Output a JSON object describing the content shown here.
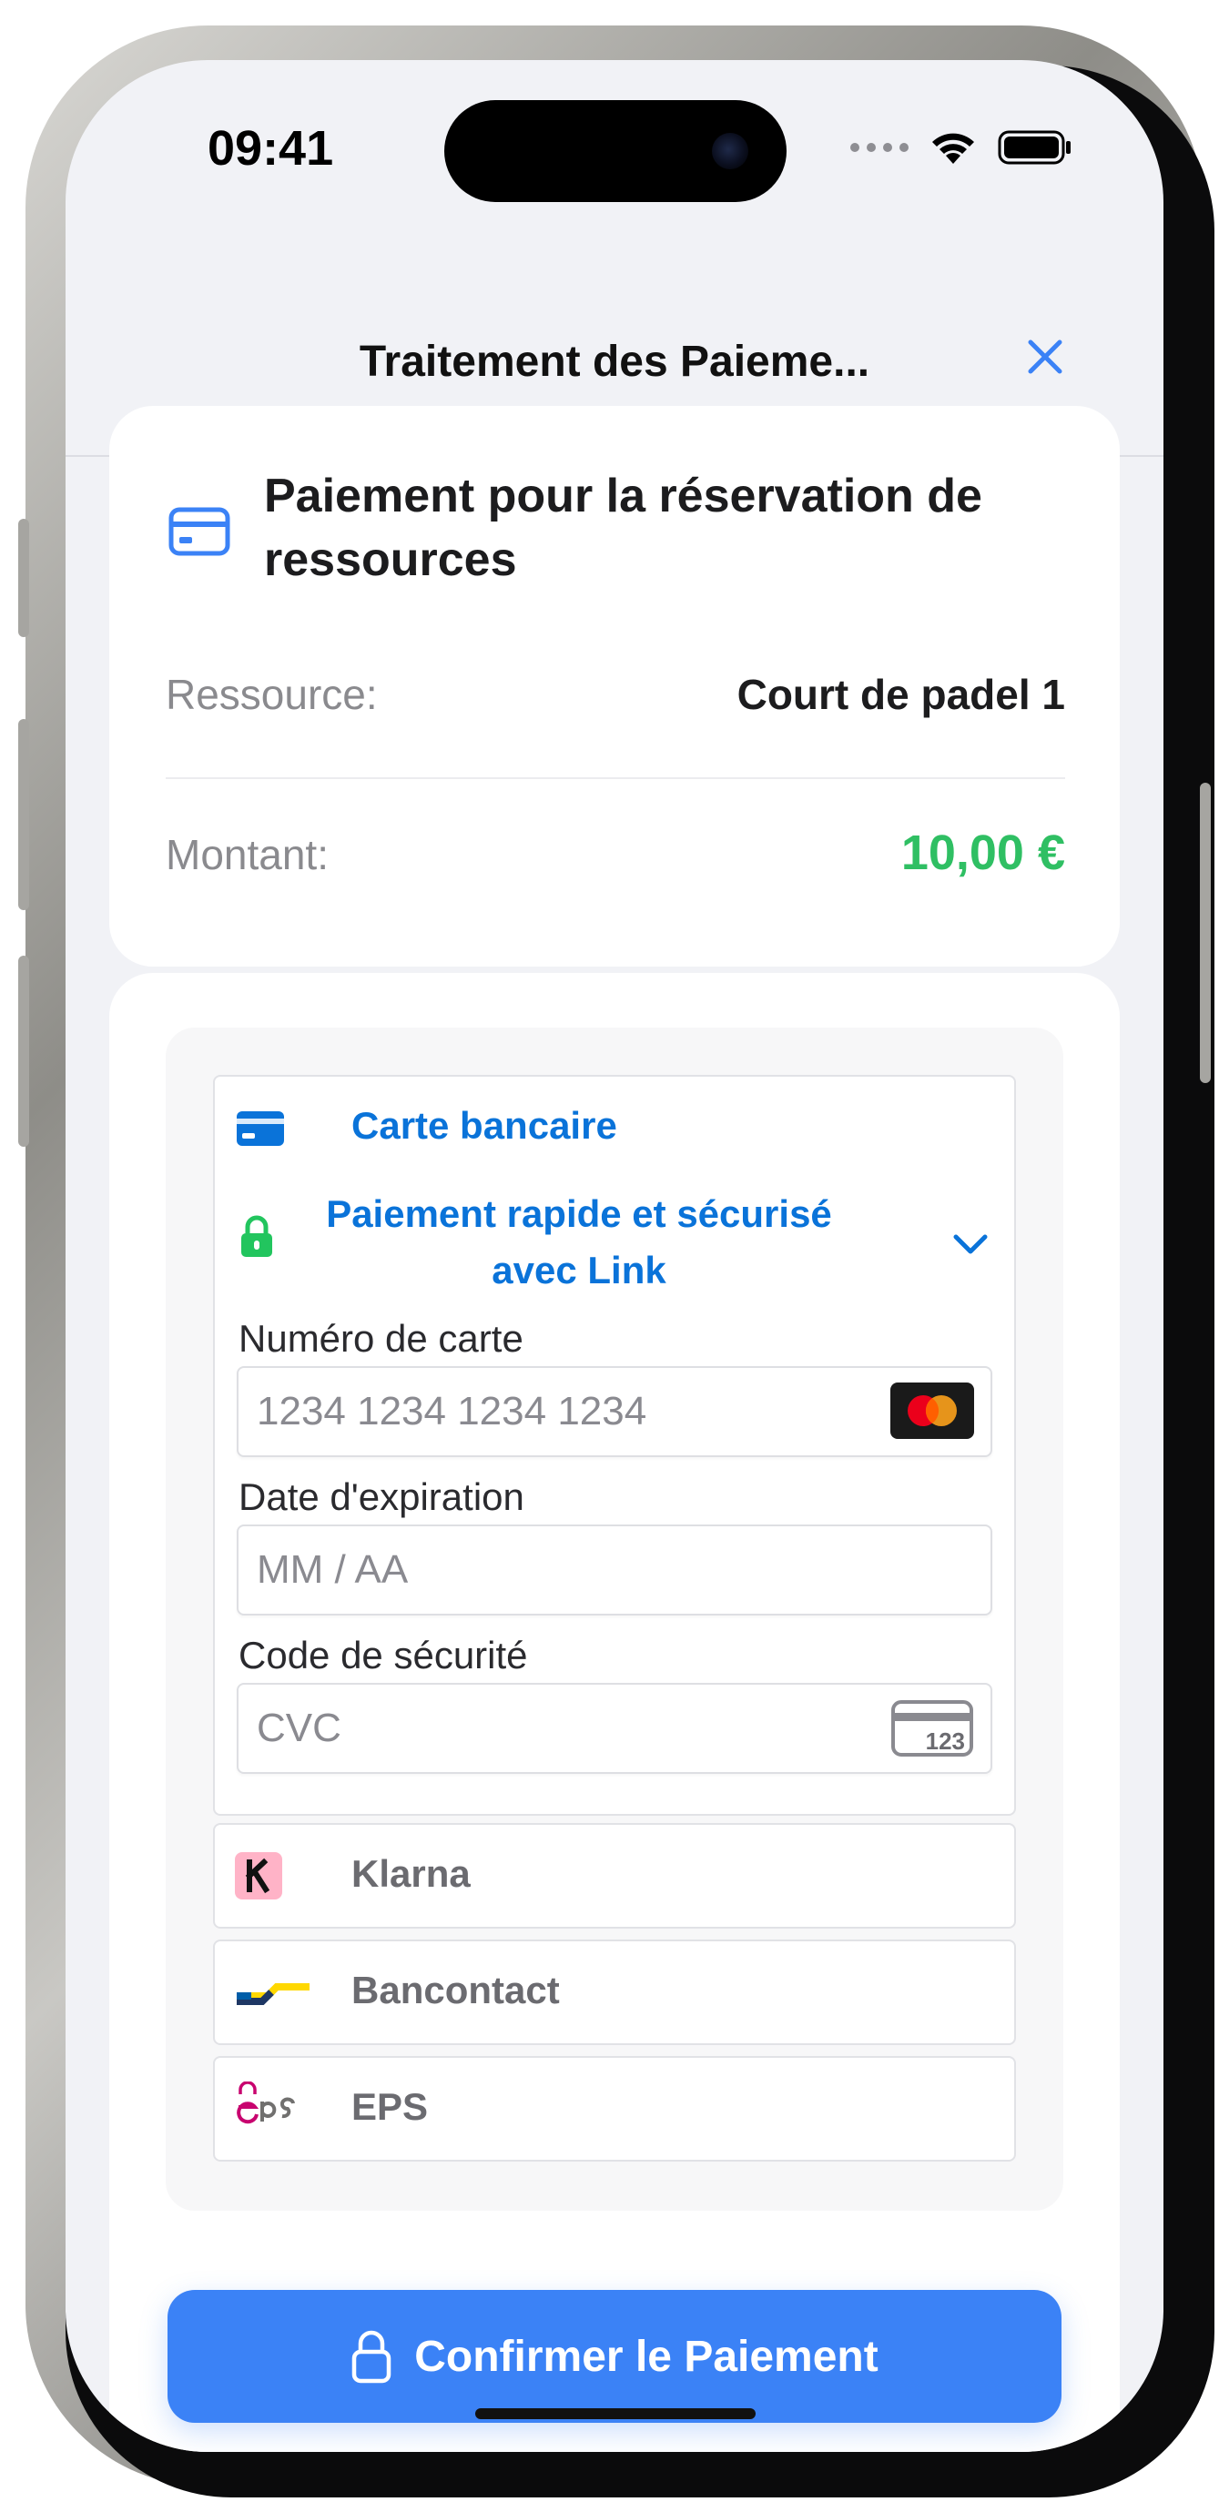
{
  "status_bar": {
    "time": "09:41"
  },
  "nav": {
    "title": "Traitement des Paieme..."
  },
  "summary": {
    "title": "Paiement pour la réservation de ressources",
    "rows": [
      {
        "label": "Ressource:",
        "value": "Court de padel 1"
      },
      {
        "label": "Montant:",
        "value": "10,00 €"
      }
    ]
  },
  "payment": {
    "card_method": {
      "label": "Carte bancaire",
      "link_text": "Paiement rapide et sécurisé avec Link",
      "fields": [
        {
          "label": "Numéro de carte",
          "placeholder": "1234 1234 1234 1234"
        },
        {
          "label": "Date d'expiration",
          "placeholder": "MM / AA"
        },
        {
          "label": "Code de sécurité",
          "placeholder": "CVC"
        }
      ],
      "cvc_icon_text": "123"
    },
    "other_methods": [
      {
        "label": "Klarna",
        "icon": "klarna-icon"
      },
      {
        "label": "Bancontact",
        "icon": "bancontact-icon"
      },
      {
        "label": "EPS",
        "icon": "eps-icon"
      }
    ]
  },
  "confirm_button": {
    "label": "Confirmer le Paiement"
  },
  "colors": {
    "accent": "#3b82f6",
    "link_blue": "#0a73d9",
    "amount_green": "#2fbf63"
  }
}
